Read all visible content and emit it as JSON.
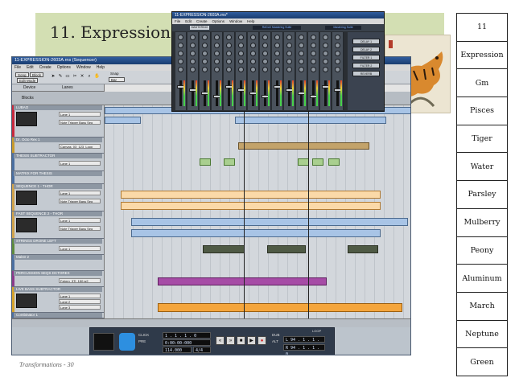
{
  "slide": {
    "title": "11. Expression",
    "footer": "Transformations - 30"
  },
  "word_list": [
    "11",
    "Expression",
    "Gm",
    "Pisces",
    "Tiger",
    "Water",
    "Parsley",
    "Mulberry",
    "Peony",
    "Aluminum",
    "March",
    "Neptune",
    "Green"
  ],
  "sequencer": {
    "title": "11-EXPRESSION-2603A.rns (Sequencer)",
    "menu": [
      "File",
      "Edit",
      "Create",
      "Options",
      "Window",
      "Help"
    ],
    "toolbar": {
      "song_label": "Song",
      "block_label": "Block",
      "edit_mode_label": "Edit Mode",
      "snap_label": "Snap",
      "snap_value": "Bar",
      "lanes_label": "Lanes"
    },
    "header": {
      "device_label": "Device",
      "blocks_label": "Blocks"
    },
    "tracks": [
      {
        "name": "LUBAO",
        "color": "#c8283c",
        "lanes": [
          "Lane 1",
          "Note Trigger Bass Seq"
        ]
      },
      {
        "name": "Dr. Octo Rex 1",
        "color": "#c79a2b",
        "lanes": [
          "Canvas_03_123_Loop"
        ]
      },
      {
        "name": "THESIS SUBTRACTOR",
        "color": "#4a6fa0",
        "lanes": [
          "Lane 1"
        ]
      },
      {
        "name": "MATRIX FOR THESIS",
        "color": "#4a6fa0",
        "lanes": []
      },
      {
        "name": "SEQUENCE 1 - THOR",
        "color": "#d0a24a",
        "lanes": [
          "Lane 1",
          "Note Trigger Bass Seq"
        ]
      },
      {
        "name": "FAST SEQUENCE 2 - THOR",
        "color": "#d0a24a",
        "lanes": [
          "Lane 1",
          "Note Trigger Bass Seq"
        ]
      },
      {
        "name": "STRINGS DRONE LEFT",
        "color": "#5d8a3e",
        "lanes": [
          "Lane 1"
        ]
      },
      {
        "name": "Malstr 2",
        "color": "#4a6fa0",
        "lanes": []
      },
      {
        "name": "PERCUSSION SEQS DCTOREX",
        "color": "#8b3a8b",
        "lanes": [
          "Fahrrn_3Ti_150 w2"
        ]
      },
      {
        "name": "LIVE BASS SUBTRACTOR",
        "color": "#d6a32a",
        "lanes": [
          "Lane 1",
          "Lane 2",
          "Lane 3"
        ]
      },
      {
        "name": "Combinator 1",
        "color": "#4a6fa0",
        "lanes": []
      }
    ],
    "transport": {
      "position": "1 . 1 . 1 . 0",
      "time": "0:00:00:000",
      "tempo": "114.000",
      "signature": "4/4",
      "left_locator": "L  94 . 1 . 1 . 0",
      "right_locator": "R  94 . 1 . 1 . 0",
      "click_label": "CLICK",
      "pre_label": "PRE",
      "loop_label": "LOOP",
      "dub_label": "DUB",
      "alt_label": "ALT"
    }
  },
  "mixer": {
    "title": "11-EXPRESSION-2603A.rns*",
    "menu": [
      "File",
      "Edit",
      "Create",
      "Options",
      "Window",
      "Help"
    ],
    "header_label": "MASTERING",
    "logo": "ReDoX Mastering Suite",
    "logo2": "Mastering Suite",
    "master_buttons": [
      "DELAY 1",
      "DELAY 2",
      "FILTER 1",
      "FILTER 2",
      "REVERB"
    ]
  },
  "colors": {
    "band": "#d3dfb3",
    "clip_blue": "#a8c4e6",
    "clip_orange": "#fbd9a8",
    "clip_olive": "#c3a36a",
    "clip_green": "#a9cf8f",
    "clip_dark": "#4f5a45",
    "clip_purple": "#a64ca6",
    "clip_gold": "#f4a53c"
  },
  "icons": [
    "arrow-tool-icon",
    "pencil-tool-icon",
    "eraser-tool-icon",
    "razor-tool-icon",
    "mute-tool-icon",
    "magnify-tool-icon",
    "hand-tool-icon",
    "rewind-icon",
    "fast-forward-icon",
    "stop-icon",
    "play-icon",
    "record-icon"
  ]
}
